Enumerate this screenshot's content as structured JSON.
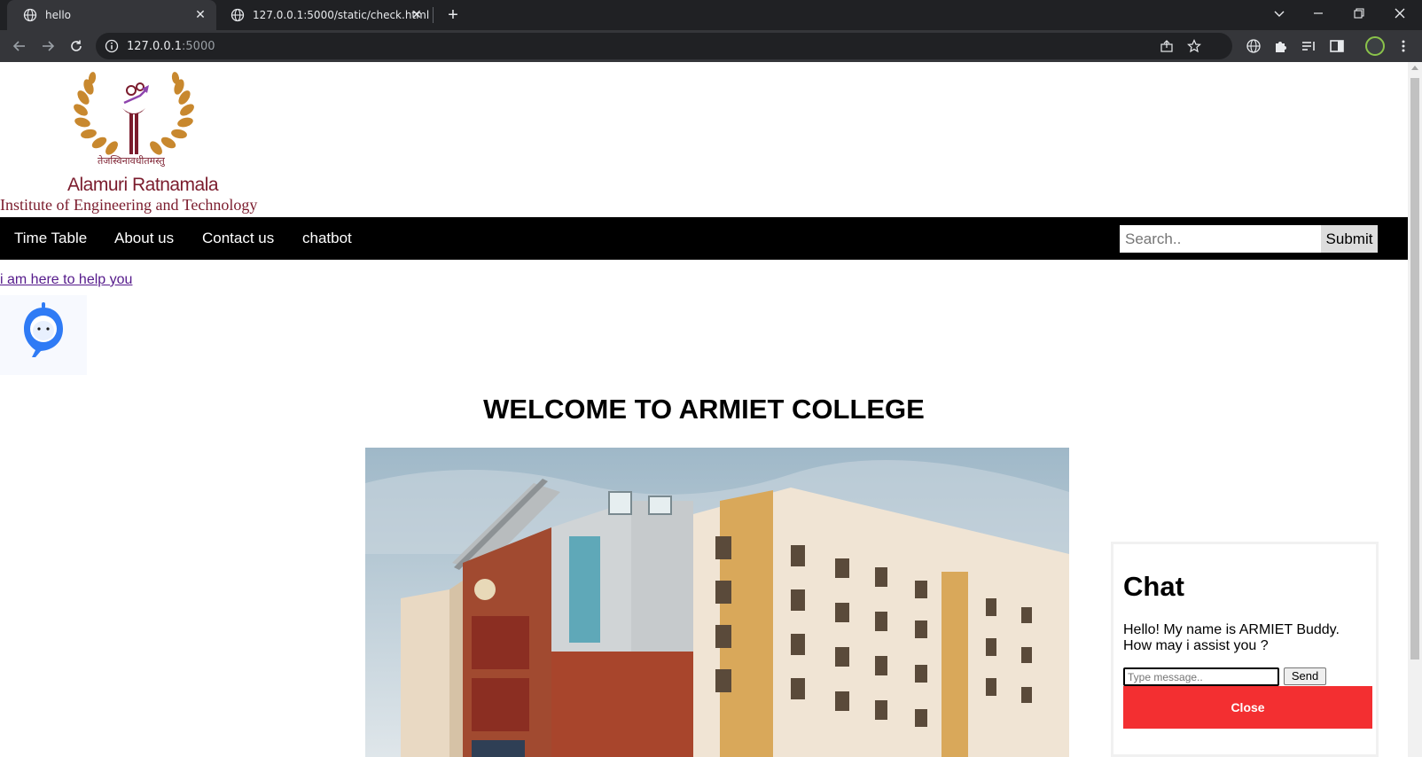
{
  "browser": {
    "tabs": [
      {
        "title": "hello",
        "active": true
      },
      {
        "title": "127.0.0.1:5000/static/check.html",
        "active": false
      }
    ],
    "address": {
      "host": "127.0.0.1",
      "port": ":5000"
    },
    "icons": [
      "back-icon",
      "forward-icon",
      "reload-icon",
      "info-icon",
      "share-icon",
      "star-icon",
      "translate-icon",
      "extensions-icon",
      "reading-list-icon",
      "side-panel-icon",
      "profile-avatar",
      "menu-icon"
    ]
  },
  "logo": {
    "motto": "तेजस्विनावधीतमस्तु",
    "name": "Alamuri Ratnamala",
    "subtitle": "Institute of Engineering and Technology"
  },
  "navbar": {
    "items": [
      "Time Table",
      "About us",
      "Contact us",
      "chatbot"
    ],
    "search_placeholder": "Search..",
    "submit_label": "Submit"
  },
  "help_link": "i am here to help you",
  "welcome": "WELCOME TO ARMIET COLLEGE",
  "chat": {
    "title": "Chat",
    "message": "Hello! My name is ARMIET Buddy. How may i assist you ?",
    "input_placeholder": "Type message..",
    "send_label": "Send",
    "close_label": "Close"
  },
  "colors": {
    "navbar": "#000000",
    "close_button": "#f32f31",
    "logo_text": "#7b1c2d",
    "laurel": "#c8882e"
  }
}
